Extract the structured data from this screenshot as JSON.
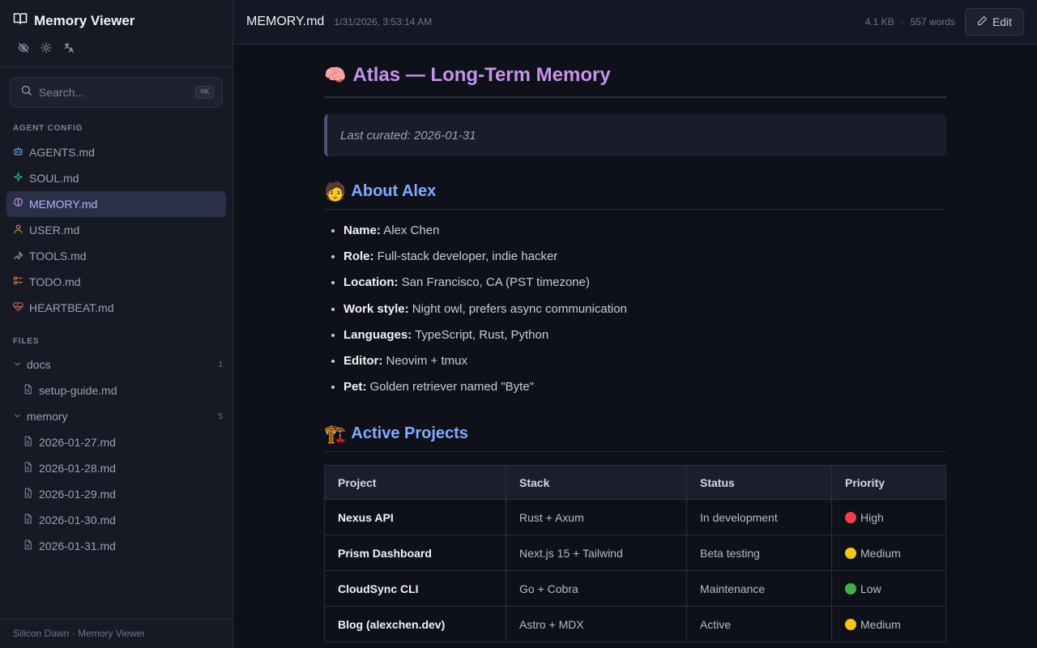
{
  "sidebar": {
    "app_title": "Memory Viewer",
    "search_placeholder": "Search...",
    "search_shortcut": "⌘K",
    "agent_config_label": "AGENT CONFIG",
    "agent_items": [
      {
        "label": "AGENTS.md",
        "icon": "bot-icon",
        "color": "#7aa2f7"
      },
      {
        "label": "SOUL.md",
        "icon": "sparkle-icon",
        "color": "#2fbf8f"
      },
      {
        "label": "MEMORY.md",
        "icon": "brain-icon",
        "color": "#c792ea",
        "active": true
      },
      {
        "label": "USER.md",
        "icon": "user-icon",
        "color": "#e0a040"
      },
      {
        "label": "TOOLS.md",
        "icon": "wrench-icon",
        "color": "#9aa0b3"
      },
      {
        "label": "TODO.md",
        "icon": "checklist-icon",
        "color": "#e0803a"
      },
      {
        "label": "HEARTBEAT.md",
        "icon": "heartbeat-icon",
        "color": "#f25f6c"
      }
    ],
    "files_label": "FILES",
    "folders": [
      {
        "name": "docs",
        "count": "1",
        "files": [
          "setup-guide.md"
        ]
      },
      {
        "name": "memory",
        "count": "5",
        "files": [
          "2026-01-27.md",
          "2026-01-28.md",
          "2026-01-29.md",
          "2026-01-30.md",
          "2026-01-31.md"
        ]
      }
    ],
    "footer": "Silicon Dawn · Memory Viewer"
  },
  "topbar": {
    "filename": "MEMORY.md",
    "modified": "1/31/2026, 3:53:14 AM",
    "size": "4.1 KB",
    "separator": "·",
    "words": "557 words",
    "edit_label": "Edit"
  },
  "doc": {
    "h1_emoji": "🧠",
    "h1": "Atlas — Long-Term Memory",
    "quote": "Last curated: 2026-01-31",
    "about_emoji": "🧑",
    "about_heading": "About Alex",
    "about": [
      {
        "key": "Name:",
        "value": "Alex Chen"
      },
      {
        "key": "Role:",
        "value": "Full-stack developer, indie hacker"
      },
      {
        "key": "Location:",
        "value": "San Francisco, CA (PST timezone)"
      },
      {
        "key": "Work style:",
        "value": "Night owl, prefers async communication"
      },
      {
        "key": "Languages:",
        "value": "TypeScript, Rust, Python"
      },
      {
        "key": "Editor:",
        "value": "Neovim + tmux"
      },
      {
        "key": "Pet:",
        "value": "Golden retriever named \"Byte\""
      }
    ],
    "projects_emoji": "🏗️",
    "projects_heading": "Active Projects",
    "table_headers": [
      "Project",
      "Stack",
      "Status",
      "Priority"
    ],
    "projects": [
      {
        "project": "Nexus API",
        "stack": "Rust + Axum",
        "status": "In development",
        "priority": "High",
        "priority_color": "#f0404a"
      },
      {
        "project": "Prism Dashboard",
        "stack": "Next.js 15 + Tailwind",
        "status": "Beta testing",
        "priority": "Medium",
        "priority_color": "#f5c518"
      },
      {
        "project": "CloudSync CLI",
        "stack": "Go + Cobra",
        "status": "Maintenance",
        "priority": "Low",
        "priority_color": "#43b047"
      },
      {
        "project": "Blog (alexchen.dev)",
        "stack": "Astro + MDX",
        "status": "Active",
        "priority": "Medium",
        "priority_color": "#f5c518"
      }
    ]
  }
}
